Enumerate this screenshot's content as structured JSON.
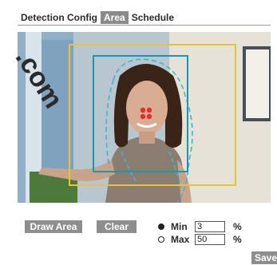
{
  "tabs": [
    {
      "label": "Detection Config",
      "active": false
    },
    {
      "label": "Area",
      "active": true
    },
    {
      "label": "Schedule",
      "active": false
    }
  ],
  "watermark": ".com",
  "buttons": {
    "draw_area": "Draw Area",
    "clear": "Clear",
    "save": "Save"
  },
  "size_range": {
    "min": {
      "label": "Min",
      "value": "3",
      "unit": "%",
      "selected": true
    },
    "max": {
      "label": "Max",
      "value": "50",
      "unit": "%",
      "selected": false
    }
  },
  "colors": {
    "tab_active_bg": "#8a8a8a",
    "button_bg": "#8e8e8e",
    "outer_box": "#e8c238",
    "inner_box": "#1a9aa8",
    "face_marker": "#e03030"
  }
}
